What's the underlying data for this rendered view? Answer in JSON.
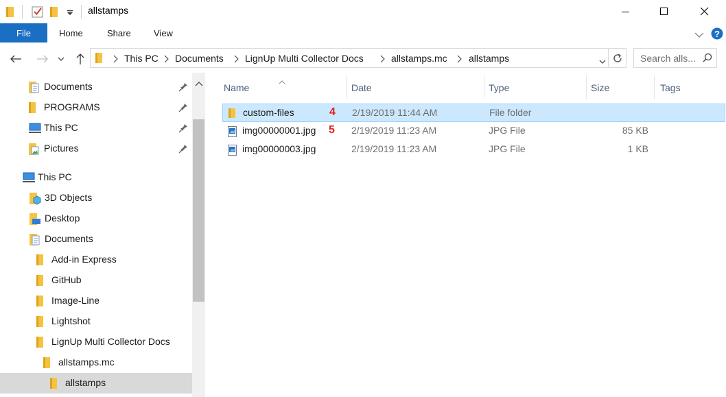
{
  "window": {
    "title": "allstamps",
    "colors": {
      "accent": "#1a6fc3",
      "selection": "#cce8ff",
      "folder": "#f5c342",
      "marker": "#e0201b"
    }
  },
  "quick_access_toolbar": {
    "icons": [
      "folder-icon",
      "properties-checkmark-icon",
      "new-folder-icon",
      "customize-dropdown-icon"
    ]
  },
  "ribbon": {
    "tabs": [
      "File",
      "Home",
      "Share",
      "View"
    ]
  },
  "address_bar": {
    "crumbs": [
      "This PC",
      "Documents",
      "LignUp Multi Collector Docs",
      "allstamps.mc",
      "allstamps"
    ]
  },
  "search": {
    "placeholder": "Search alls..."
  },
  "nav_pane": {
    "quick_access": [
      {
        "label": "Documents",
        "icon": "documents-icon",
        "pinned": true
      },
      {
        "label": "PROGRAMS",
        "icon": "folder-icon",
        "pinned": true
      },
      {
        "label": "This PC",
        "icon": "computer-icon",
        "pinned": true
      },
      {
        "label": "Pictures",
        "icon": "pictures-icon",
        "pinned": true
      }
    ],
    "this_pc": {
      "label": "This PC"
    },
    "tree": [
      {
        "label": "3D Objects",
        "icon": "3d-objects-icon"
      },
      {
        "label": "Desktop",
        "icon": "desktop-icon"
      },
      {
        "label": "Documents",
        "icon": "documents-icon"
      },
      {
        "label": "Add-in Express",
        "icon": "folder-icon"
      },
      {
        "label": "GitHub",
        "icon": "folder-icon"
      },
      {
        "label": "Image-Line",
        "icon": "folder-icon"
      },
      {
        "label": "Lightshot",
        "icon": "folder-icon"
      },
      {
        "label": "LignUp Multi Collector Docs",
        "icon": "folder-icon"
      },
      {
        "label": "allstamps.mc",
        "icon": "folder-icon"
      },
      {
        "label": "allstamps",
        "icon": "folder-icon",
        "selected": true
      }
    ]
  },
  "file_list": {
    "columns": [
      "Name",
      "Date",
      "Type",
      "Size",
      "Tags"
    ],
    "rows": [
      {
        "name": "custom-files",
        "marker": "4",
        "date": "2/19/2019 11:44 AM",
        "type": "File folder",
        "size": "",
        "icon": "folder-icon",
        "selected": true
      },
      {
        "name": "img00000001.jpg",
        "marker": "5",
        "date": "2/19/2019 11:23 AM",
        "type": "JPG File",
        "size": "85 KB",
        "icon": "image-file-icon",
        "selected": false
      },
      {
        "name": "img00000003.jpg",
        "marker": "",
        "date": "2/19/2019 11:23 AM",
        "type": "JPG File",
        "size": "1 KB",
        "icon": "image-file-icon",
        "selected": false
      }
    ]
  }
}
